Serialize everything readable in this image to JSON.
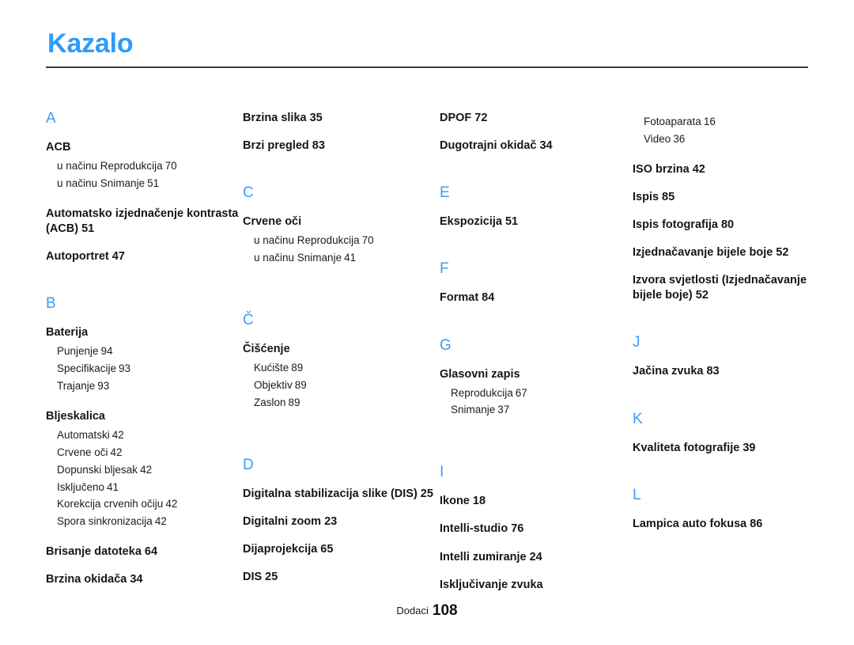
{
  "document": {
    "title": "Kazalo",
    "accent_color": "#2e9bfb",
    "letter_color": "#3b9bfb",
    "text_color": "#161616"
  },
  "footer": {
    "label": "Dodaci",
    "page_number": "108"
  },
  "columns": [
    {
      "id": "column-1",
      "sections": [
        {
          "letter": "A",
          "entries": [
            {
              "title": "ACB",
              "page": "",
              "subentries": [
                {
                  "text": "u načinu Reprodukcija",
                  "page": "70"
                },
                {
                  "text": "u načinu Snimanje",
                  "page": "51"
                }
              ]
            },
            {
              "title": "Automatsko izjednačenje kontrasta (ACB)",
              "page": "51",
              "subentries": []
            },
            {
              "title": "Autoportret",
              "page": "47",
              "subentries": []
            }
          ]
        },
        {
          "letter": "B",
          "entries": [
            {
              "title": "Baterija",
              "page": "",
              "subentries": [
                {
                  "text": "Punjenje",
                  "page": "94"
                },
                {
                  "text": "Specifikacije",
                  "page": "93"
                },
                {
                  "text": "Trajanje",
                  "page": "93"
                }
              ]
            },
            {
              "title": "Bljeskalica",
              "page": "",
              "subentries": [
                {
                  "text": "Automatski",
                  "page": "42"
                },
                {
                  "text": "Crvene oči",
                  "page": "42"
                },
                {
                  "text": "Dopunski bljesak",
                  "page": "42"
                },
                {
                  "text": "Isključeno",
                  "page": "41"
                },
                {
                  "text": "Korekcija crvenih očiju",
                  "page": "42"
                },
                {
                  "text": "Spora sinkronizacija",
                  "page": "42"
                }
              ]
            },
            {
              "title": "Brisanje datoteka",
              "page": "64",
              "subentries": []
            },
            {
              "title": "Brzina okidača",
              "page": "34",
              "subentries": []
            }
          ]
        }
      ]
    },
    {
      "id": "column-2",
      "sections": [
        {
          "letter": "",
          "entries": [
            {
              "title": "Brzina slika",
              "page": "35",
              "subentries": []
            },
            {
              "title": "Brzi pregled",
              "page": "83",
              "subentries": []
            }
          ]
        },
        {
          "letter": "C",
          "entries": [
            {
              "title": "Crvene oči",
              "page": "",
              "subentries": [
                {
                  "text": "u načinu Reprodukcija",
                  "page": "70"
                },
                {
                  "text": "u načinu Snimanje",
                  "page": "41"
                }
              ]
            }
          ]
        },
        {
          "letter": "Č",
          "entries": [
            {
              "title": "Čišćenje",
              "page": "",
              "subentries": [
                {
                  "text": "Kućište",
                  "page": "89"
                },
                {
                  "text": "Objektiv",
                  "page": "89"
                },
                {
                  "text": "Zaslon",
                  "page": "89"
                }
              ]
            }
          ]
        },
        {
          "letter": "D",
          "entries": [
            {
              "title": "Digitalna stabilizacija slike (DIS)",
              "page": "25",
              "subentries": []
            },
            {
              "title": "Digitalni zoom",
              "page": "23",
              "subentries": []
            },
            {
              "title": "Dijaprojekcija",
              "page": "65",
              "subentries": []
            },
            {
              "title": "DIS",
              "page": "25",
              "subentries": []
            }
          ]
        }
      ]
    },
    {
      "id": "column-3",
      "sections": [
        {
          "letter": "",
          "entries": [
            {
              "title": "DPOF",
              "page": "72",
              "subentries": []
            },
            {
              "title": "Dugotrajni okidač",
              "page": "34",
              "subentries": []
            }
          ]
        },
        {
          "letter": "E",
          "entries": [
            {
              "title": "Ekspozicija",
              "page": "51",
              "subentries": []
            }
          ]
        },
        {
          "letter": "F",
          "entries": [
            {
              "title": "Format",
              "page": "84",
              "subentries": []
            }
          ]
        },
        {
          "letter": "G",
          "entries": [
            {
              "title": "Glasovni zapis",
              "page": "",
              "subentries": [
                {
                  "text": "Reprodukcija",
                  "page": "67"
                },
                {
                  "text": "Snimanje",
                  "page": "37"
                }
              ]
            }
          ]
        },
        {
          "letter": "I",
          "entries": [
            {
              "title": "Ikone",
              "page": "18",
              "subentries": []
            },
            {
              "title": "Intelli-studio",
              "page": "76",
              "subentries": []
            },
            {
              "title": "Intelli zumiranje",
              "page": "24",
              "subentries": []
            },
            {
              "title": "Isključivanje zvuka",
              "page": "",
              "subentries": []
            }
          ]
        }
      ]
    },
    {
      "id": "column-4",
      "sections": [
        {
          "letter": "",
          "entries": [
            {
              "title": "",
              "page": "",
              "subentries": [
                {
                  "text": "Fotoaparata",
                  "page": "16"
                },
                {
                  "text": "Video",
                  "page": "36"
                }
              ]
            },
            {
              "title": "ISO brzina",
              "page": "42",
              "subentries": []
            },
            {
              "title": "Ispis",
              "page": "85",
              "subentries": []
            },
            {
              "title": "Ispis fotografija",
              "page": "80",
              "subentries": []
            },
            {
              "title": "Izjednačavanje bijele boje",
              "page": "52",
              "subentries": []
            },
            {
              "title": "Izvora svjetlosti (Izjednačavanje bijele boje)",
              "page": "52",
              "subentries": []
            }
          ]
        },
        {
          "letter": "J",
          "entries": [
            {
              "title": "Jačina zvuka",
              "page": "83",
              "subentries": []
            }
          ]
        },
        {
          "letter": "K",
          "entries": [
            {
              "title": "Kvaliteta fotografije",
              "page": "39",
              "subentries": []
            }
          ]
        },
        {
          "letter": "L",
          "entries": [
            {
              "title": "Lampica auto fokusa",
              "page": "86",
              "subentries": []
            }
          ]
        }
      ]
    }
  ]
}
